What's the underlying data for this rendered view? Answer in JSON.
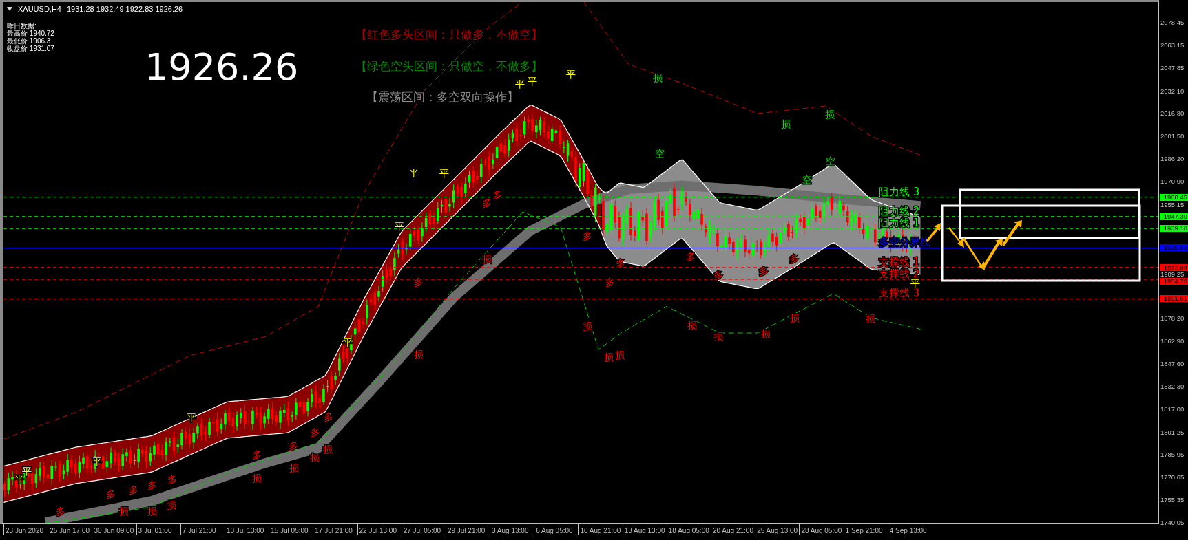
{
  "header": {
    "symbol": "XAUUSD,H4",
    "ohlc": "1931.28 1932.49 1922.83 1926.26"
  },
  "info": {
    "title": "昨日数据:",
    "lines": [
      "最高价 1940.72",
      "最低价 1906.3",
      "收盘价 1931.07"
    ]
  },
  "big_price": "1926.26",
  "legend": [
    {
      "text": "【红色多头区间：只做多，不做空】",
      "color": "#b00000"
    },
    {
      "text": "【绿色空头区间：只做空，不做多】",
      "color": "#008800"
    },
    {
      "text": "【震荡区间：多空双向操作】",
      "color": "#8c8c8c"
    }
  ],
  "price_axis": [
    "2078.45",
    "2063.15",
    "2047.85",
    "2032.10",
    "2016.80",
    "2001.50",
    "1986.20",
    "1970.90",
    "1955.15",
    "1909.25",
    "1878.20",
    "1862.90",
    "1847.60",
    "1832.30",
    "1817.00",
    "1801.25",
    "1785.95",
    "1770.65",
    "1755.35",
    "1740.05"
  ],
  "levels": [
    {
      "kind": "resistance",
      "label": "阻力线 3",
      "tag": "1960.45",
      "color": "#00ff00"
    },
    {
      "kind": "resistance",
      "label": "阻力线 2",
      "tag": "1947.30",
      "color": "#00ff00"
    },
    {
      "kind": "resistance",
      "label": "阻力线 1",
      "tag": "1939.18",
      "color": "#00ff00"
    },
    {
      "kind": "boundary",
      "label": "多空分界线",
      "tag": "1926.03",
      "color": "#0000ff"
    },
    {
      "kind": "support",
      "label": "支撑线 1",
      "tag": "1912.88",
      "color": "#ff0000"
    },
    {
      "kind": "support",
      "label": "支撑线 2",
      "tag": "1904.76",
      "color": "#ff0000"
    },
    {
      "kind": "support",
      "label": "支撑线 3",
      "tag": "1891.61",
      "color": "#ff0000"
    }
  ],
  "time_axis": [
    "23 Jun 2020",
    "25 Jun 17:00",
    "30 Jun 09:00",
    "3 Jul 01:00",
    "7 Jul 21:00",
    "10 Jul 13:00",
    "15 Jul 05:00",
    "17 Jul 21:00",
    "22 Jul 13:00",
    "27 Jul 05:00",
    "29 Jul 21:00",
    "3 Aug 13:00",
    "6 Aug 05:00",
    "10 Aug 21:00",
    "13 Aug 13:00",
    "18 Aug 05:00",
    "20 Aug 21:00",
    "25 Aug 13:00",
    "28 Aug 05:00",
    "1 Sep 21:00",
    "4 Sep 13:00"
  ],
  "markers": [
    {
      "text": "平",
      "kind": "close"
    },
    {
      "text": "平",
      "kind": "close"
    },
    {
      "text": "平",
      "kind": "close"
    },
    {
      "text": "平",
      "kind": "close"
    },
    {
      "text": "平",
      "kind": "close"
    },
    {
      "text": "平",
      "kind": "close"
    },
    {
      "text": "平",
      "kind": "close"
    },
    {
      "text": "平",
      "kind": "close"
    },
    {
      "text": "平",
      "kind": "close"
    },
    {
      "text": "平",
      "kind": "close"
    },
    {
      "text": "平",
      "kind": "close"
    },
    {
      "text": "平",
      "kind": "close"
    },
    {
      "text": "多",
      "kind": "long"
    },
    {
      "text": "多",
      "kind": "long"
    },
    {
      "text": "多",
      "kind": "long"
    },
    {
      "text": "多",
      "kind": "long"
    },
    {
      "text": "多",
      "kind": "long"
    },
    {
      "text": "多",
      "kind": "long"
    },
    {
      "text": "多",
      "kind": "long"
    },
    {
      "text": "多",
      "kind": "long"
    },
    {
      "text": "多",
      "kind": "long"
    },
    {
      "text": "多",
      "kind": "long"
    },
    {
      "text": "多",
      "kind": "long"
    },
    {
      "text": "多",
      "kind": "long"
    },
    {
      "text": "多",
      "kind": "long"
    },
    {
      "text": "多",
      "kind": "long"
    },
    {
      "text": "多",
      "kind": "long"
    },
    {
      "text": "多",
      "kind": "long"
    },
    {
      "text": "多",
      "kind": "long"
    },
    {
      "text": "多",
      "kind": "long"
    },
    {
      "text": "多",
      "kind": "long"
    },
    {
      "text": "损",
      "kind": "stop_long"
    },
    {
      "text": "损",
      "kind": "stop_long"
    },
    {
      "text": "损",
      "kind": "stop_long"
    },
    {
      "text": "损",
      "kind": "stop_long"
    },
    {
      "text": "损",
      "kind": "stop_long"
    },
    {
      "text": "损",
      "kind": "stop_long"
    },
    {
      "text": "损",
      "kind": "stop_long"
    },
    {
      "text": "损",
      "kind": "stop_long"
    },
    {
      "text": "损",
      "kind": "stop_long"
    },
    {
      "text": "损",
      "kind": "stop_long"
    },
    {
      "text": "损",
      "kind": "stop_long"
    },
    {
      "text": "损",
      "kind": "stop_long"
    },
    {
      "text": "损",
      "kind": "stop_long"
    },
    {
      "text": "损",
      "kind": "stop_long"
    },
    {
      "text": "损",
      "kind": "stop_long"
    },
    {
      "text": "损",
      "kind": "stop_long"
    },
    {
      "text": "损",
      "kind": "stop_long"
    },
    {
      "text": "损",
      "kind": "stop_short"
    },
    {
      "text": "损",
      "kind": "stop_short"
    },
    {
      "text": "损",
      "kind": "stop_short"
    },
    {
      "text": "空",
      "kind": "short"
    },
    {
      "text": "空",
      "kind": "short"
    },
    {
      "text": "空",
      "kind": "short"
    }
  ]
}
